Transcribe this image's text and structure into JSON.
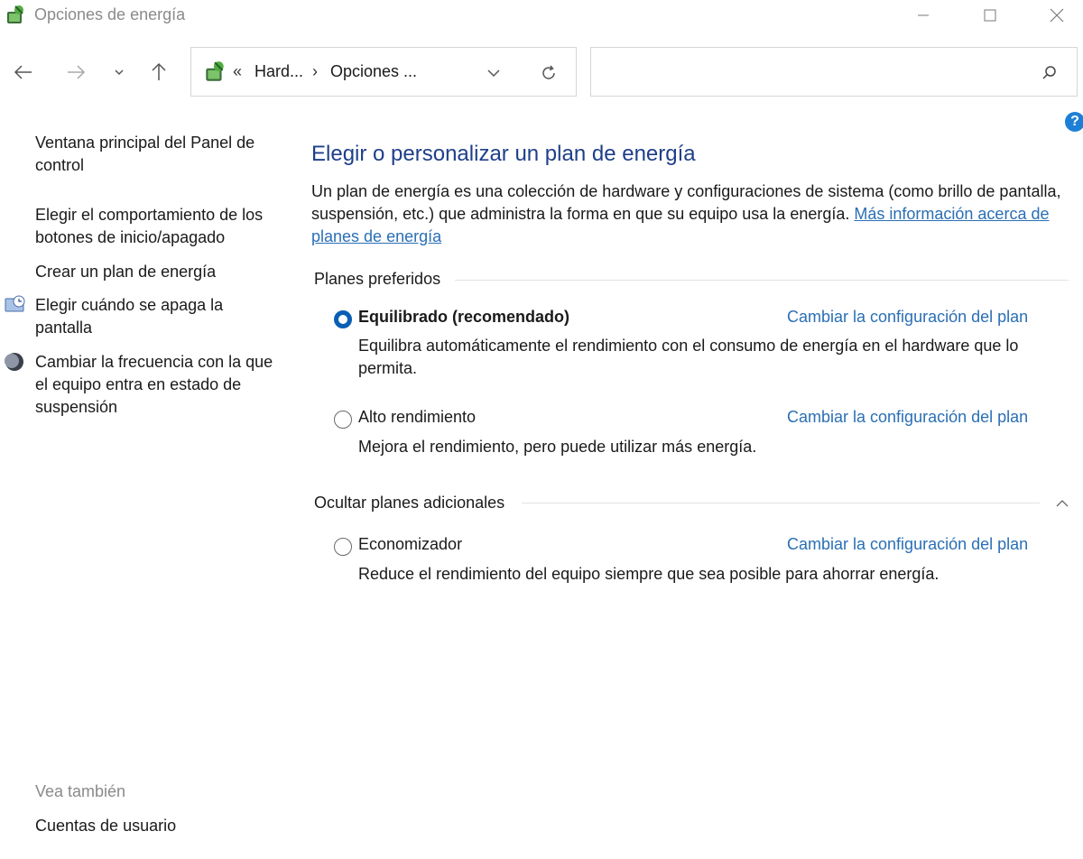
{
  "window": {
    "title": "Opciones de energía",
    "icon": "power-options-icon"
  },
  "address_bar": {
    "overflow": "«",
    "crumbs": [
      "Hard...",
      "Opciones ..."
    ],
    "separator": "›"
  },
  "search": {
    "placeholder": "",
    "value": ""
  },
  "help": {
    "label": "?"
  },
  "sidebar": {
    "items": [
      {
        "label": "Ventana principal del Panel de control",
        "icon": null
      },
      {
        "label": "Elegir el comportamiento de los botones de inicio/apagado",
        "icon": null
      },
      {
        "label": "Crear un plan de energía",
        "icon": null
      },
      {
        "label": "Elegir cuándo se apaga la pantalla",
        "icon": "display-clock-icon"
      },
      {
        "label": "Cambiar la frecuencia con la que el equipo entra en estado de suspensión",
        "icon": "moon-icon"
      }
    ],
    "see_also_label": "Vea también",
    "see_also_items": [
      "Cuentas de usuario"
    ]
  },
  "main": {
    "title": "Elegir o personalizar un plan de energía",
    "intro_text": "Un plan de energía es una colección de hardware y configuraciones de sistema (como brillo de pantalla, suspensión, etc.) que administra la forma en que su equipo usa la energía. ",
    "intro_link": "Más información acerca de planes de energía",
    "preferred_heading": "Planes preferidos",
    "additional_heading": "Ocultar planes adicionales",
    "plans": [
      {
        "name": "Equilibrado (recomendado)",
        "selected": true,
        "description": "Equilibra automáticamente el rendimiento con el consumo de energía en el hardware que lo permita.",
        "link": "Cambiar la configuración del plan"
      },
      {
        "name": "Alto rendimiento",
        "selected": false,
        "description": "Mejora el rendimiento, pero puede utilizar más energía.",
        "link": "Cambiar la configuración del plan"
      }
    ],
    "additional_plans": [
      {
        "name": "Economizador",
        "selected": false,
        "description": "Reduce el rendimiento del equipo siempre que sea posible para ahorrar energía.",
        "link": "Cambiar la configuración del plan"
      }
    ]
  },
  "colors": {
    "title_blue": "#1e3f8a",
    "link_blue": "#2a6fb5",
    "radio_selected": "#0a5fb4",
    "help_blue": "#1e7fd6"
  }
}
